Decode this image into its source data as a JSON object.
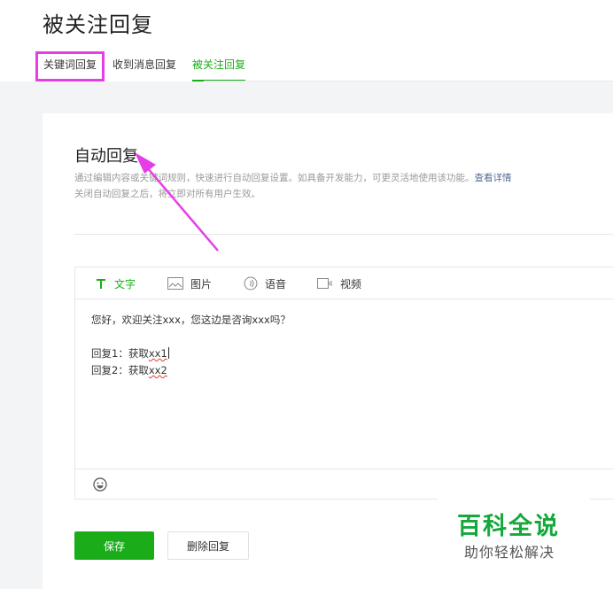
{
  "page": {
    "title": "被关注回复"
  },
  "tabs": [
    {
      "label": "关键词回复"
    },
    {
      "label": "收到消息回复"
    },
    {
      "label": "被关注回复"
    }
  ],
  "section": {
    "title": "自动回复",
    "desc_line1": "通过编辑内容或关键词规则，快速进行自动回复设置。如具备开发能力，可更灵活地使用该功能。",
    "desc_link": "查看详情",
    "desc_line2": "关闭自动回复之后，将立即对所有用户生效。"
  },
  "editor": {
    "tools": [
      {
        "label": "文字",
        "icon": "text-icon"
      },
      {
        "label": "图片",
        "icon": "image-icon"
      },
      {
        "label": "语音",
        "icon": "voice-icon"
      },
      {
        "label": "视频",
        "icon": "video-icon"
      }
    ],
    "line1": "您好，欢迎关注xxx，您这边是咨询xxx吗？",
    "line2_prefix": "回复1：获取",
    "line2_word": "xx1",
    "line3_prefix": "回复2：获取",
    "line3_word": "xx2",
    "emoji_icon": "emoji-icon"
  },
  "buttons": {
    "save": "保存",
    "delete": "删除回复"
  },
  "watermark": {
    "title": "百科全说",
    "subtitle": "助你轻松解决"
  },
  "colors": {
    "accent": "#1aad19",
    "highlight": "#e63ee6",
    "link": "#576b95"
  }
}
